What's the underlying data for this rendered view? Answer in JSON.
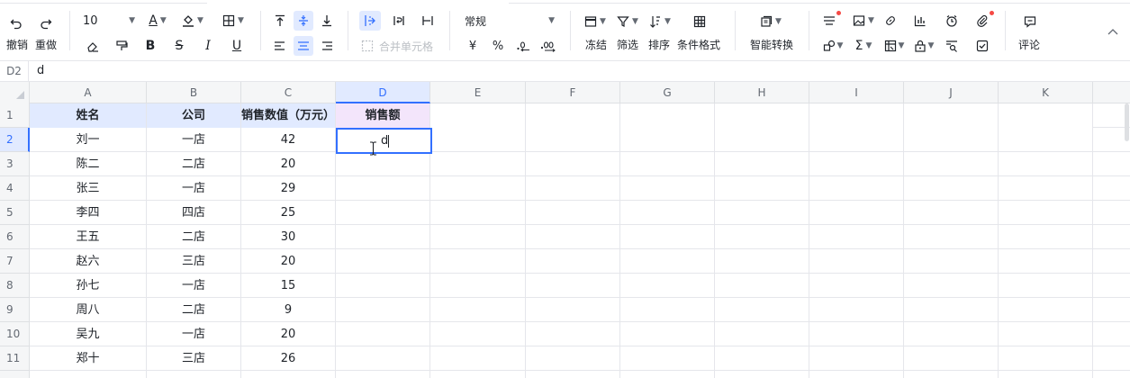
{
  "toolbar": {
    "undo_label": "撤销",
    "redo_label": "重做",
    "font_size": "10",
    "merge_cells_label": "合并单元格",
    "number_format": "常规",
    "currency_symbol": "¥",
    "percent_symbol": "%",
    "freeze_label": "冻结",
    "filter_label": "筛选",
    "sort_label": "排序",
    "conditional_format_label": "条件格式",
    "smart_convert_label": "智能转换",
    "comment_label": "评论"
  },
  "formula_bar": {
    "cell_ref": "D2",
    "value": "d"
  },
  "grid": {
    "columns": [
      "A",
      "B",
      "C",
      "D",
      "E",
      "F",
      "G",
      "H",
      "I",
      "J",
      "K"
    ],
    "row_numbers": [
      "1",
      "2",
      "3",
      "4",
      "5",
      "6",
      "7",
      "8",
      "9",
      "10",
      "11"
    ],
    "header": [
      "姓名",
      "公司",
      "销售数值（万元）",
      "销售额"
    ],
    "rows": [
      [
        "刘一",
        "一店",
        "42",
        ""
      ],
      [
        "陈二",
        "二店",
        "20",
        ""
      ],
      [
        "张三",
        "一店",
        "29",
        ""
      ],
      [
        "李四",
        "四店",
        "25",
        ""
      ],
      [
        "王五",
        "二店",
        "30",
        ""
      ],
      [
        "赵六",
        "三店",
        "20",
        ""
      ],
      [
        "孙七",
        "一店",
        "15",
        ""
      ],
      [
        "周八",
        "二店",
        "9",
        ""
      ],
      [
        "吴九",
        "一店",
        "20",
        ""
      ],
      [
        "郑十",
        "三店",
        "26",
        ""
      ]
    ],
    "active_cell": "D2",
    "editing_value": "d"
  },
  "colors": {
    "accent": "#3370ff",
    "header_fill": "#e1eaff",
    "header_fill_d": "#f3e5fb",
    "notification_dot": "#f54a45"
  }
}
